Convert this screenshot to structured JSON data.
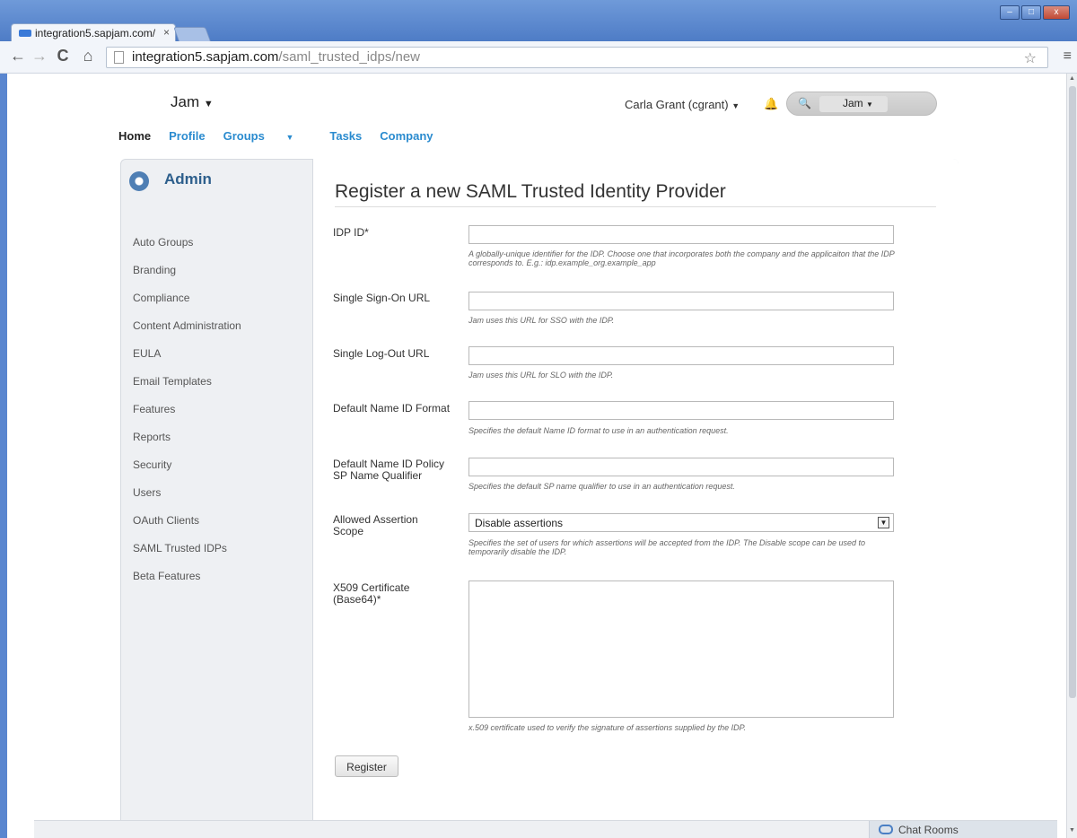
{
  "browser": {
    "tab_title": "integration5.sapjam.com/",
    "tab_close": "×",
    "url_host": "integration5.sapjam.com",
    "url_path": "/saml_trusted_idps/new",
    "window_controls": [
      "–",
      "□",
      "x"
    ]
  },
  "header": {
    "logo": "Jam",
    "user": "Carla Grant (cgrant)",
    "search_scope": "Jam"
  },
  "nav": {
    "home": "Home",
    "profile": "Profile",
    "groups": "Groups",
    "tasks": "Tasks",
    "company": "Company"
  },
  "sidebar": {
    "title": "Admin",
    "items": [
      "Auto Groups",
      "Branding",
      "Compliance",
      "Content Administration",
      "EULA",
      "Email Templates",
      "Features",
      "Reports",
      "Security",
      "Users",
      "OAuth Clients",
      "SAML Trusted IDPs",
      "Beta Features"
    ]
  },
  "form": {
    "title": "Register a new SAML Trusted Identity Provider",
    "idp_id_label": "IDP ID*",
    "idp_id_help": "A globally-unique identifier for the IDP. Choose one that incorporates both the company and the applicaiton that the IDP corresponds to. E.g.: idp.example_org.example_app",
    "sso_label": "Single Sign-On URL",
    "sso_help": "Jam uses this URL for SSO with the IDP.",
    "slo_label": "Single Log-Out URL",
    "slo_help": "Jam uses this URL for SLO with the IDP.",
    "name_id_format_label": "Default Name ID Format",
    "name_id_format_help": "Specifies the default Name ID format to use in an authentication request.",
    "sp_qualifier_label_1": "Default Name ID Policy",
    "sp_qualifier_label_2": "SP Name Qualifier",
    "sp_qualifier_help": "Specifies the default SP name qualifier to use in an authentication request.",
    "scope_label_1": "Allowed Assertion",
    "scope_label_2": "Scope",
    "scope_value": "Disable assertions",
    "scope_help": "Specifies the set of users for which assertions will be accepted from the IDP. The Disable scope can be used to temporarily disable the IDP.",
    "cert_label_1": "X509 Certificate",
    "cert_label_2": "(Base64)*",
    "cert_help": "x.509 certificate used to verify the signature of assertions supplied by the IDP.",
    "register_button": "Register"
  },
  "chat": {
    "label": "Chat Rooms"
  }
}
